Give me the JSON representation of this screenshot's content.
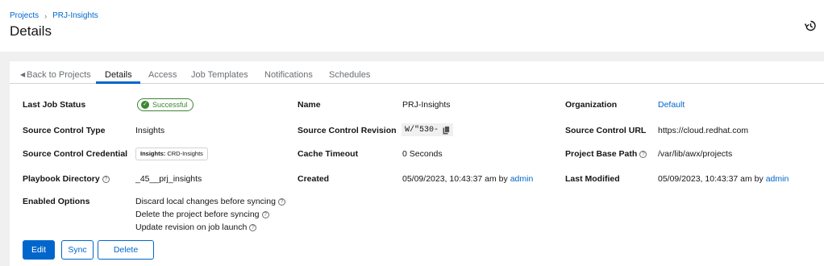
{
  "breadcrumb": {
    "projects": "Projects",
    "separator": "›",
    "current": "PRJ-Insights"
  },
  "page_title": "Details",
  "tabs": [
    {
      "label": "Back to Projects",
      "icon": "caret-left-icon"
    },
    {
      "label": "Details",
      "active": true
    },
    {
      "label": "Access"
    },
    {
      "label": "Job Templates"
    },
    {
      "label": "Notifications"
    },
    {
      "label": "Schedules"
    }
  ],
  "details": {
    "last_job_status": {
      "label": "Last Job Status",
      "value": "Successful"
    },
    "name": {
      "label": "Name",
      "value": "PRJ-Insights"
    },
    "organization": {
      "label": "Organization",
      "value": "Default"
    },
    "source_control_type": {
      "label": "Source Control Type",
      "value": "Insights"
    },
    "source_control_revision": {
      "label": "Source Control Revision",
      "value": "W/\"530-"
    },
    "source_control_url": {
      "label": "Source Control URL",
      "value": "https://cloud.redhat.com"
    },
    "source_control_credential": {
      "label": "Source Control Credential",
      "type": "Insights:",
      "value": "CRD-Insights"
    },
    "cache_timeout": {
      "label": "Cache Timeout",
      "value": "0 Seconds"
    },
    "project_base_path": {
      "label": "Project Base Path",
      "value": "/var/lib/awx/projects"
    },
    "playbook_directory": {
      "label": "Playbook Directory",
      "value": "_45__prj_insights"
    },
    "created": {
      "label": "Created",
      "date": "05/09/2023, 10:43:37 am by",
      "user": "admin"
    },
    "last_modified": {
      "label": "Last Modified",
      "date": "05/09/2023, 10:43:37 am by",
      "user": "admin"
    },
    "enabled_options": {
      "label": "Enabled Options",
      "items": [
        "Discard local changes before syncing",
        "Delete the project before syncing",
        "Update revision on job launch"
      ]
    }
  },
  "buttons": {
    "edit": "Edit",
    "sync": "Sync",
    "delete": "Delete"
  },
  "colors": {
    "primary": "#0066cc",
    "success": "#3e8635",
    "background": "#f0f0f0"
  }
}
